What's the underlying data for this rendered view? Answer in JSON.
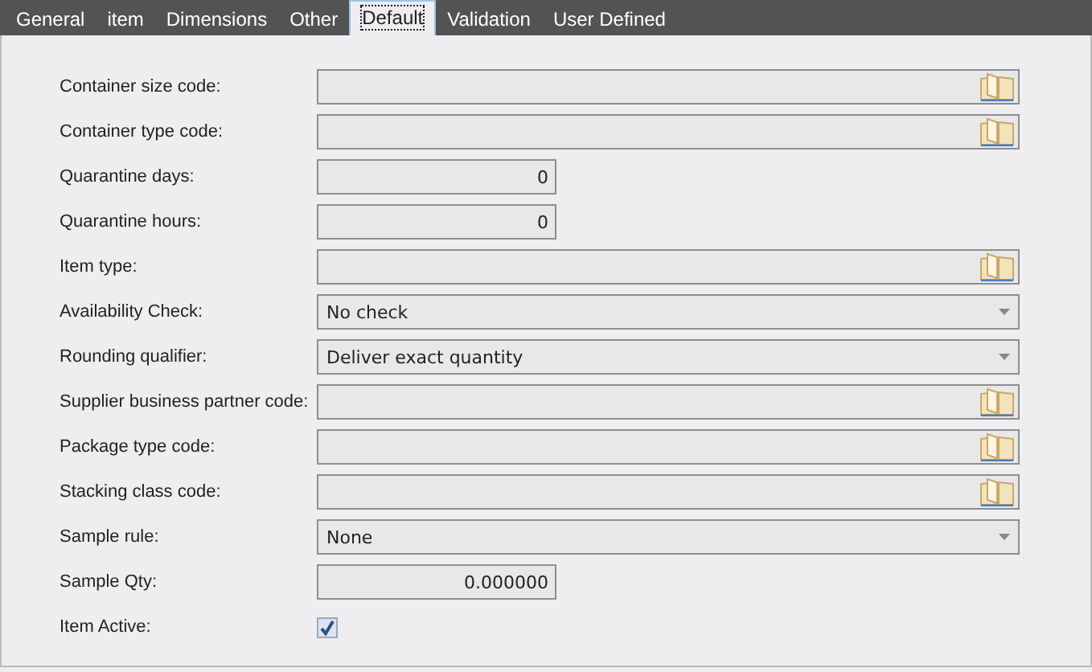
{
  "tabs": [
    {
      "label": "General",
      "selected": false
    },
    {
      "label": "item",
      "selected": false
    },
    {
      "label": "Dimensions",
      "selected": false
    },
    {
      "label": "Other",
      "selected": false
    },
    {
      "label": "Default",
      "selected": true
    },
    {
      "label": "Validation",
      "selected": false
    },
    {
      "label": "User Defined",
      "selected": false
    }
  ],
  "fields": [
    {
      "label": "Container size code:",
      "kind": "lookup"
    },
    {
      "label": "Container type code:",
      "kind": "lookup"
    },
    {
      "label": "Quarantine days:",
      "kind": "number",
      "value": "0"
    },
    {
      "label": "Quarantine hours:",
      "kind": "number",
      "value": "0"
    },
    {
      "label": "Item type:",
      "kind": "lookup"
    },
    {
      "label": "Availability Check:",
      "kind": "select",
      "value": "No check"
    },
    {
      "label": "Rounding qualifier:",
      "kind": "select",
      "value": "Deliver exact quantity"
    },
    {
      "label": "Supplier business partner code:",
      "kind": "lookup"
    },
    {
      "label": "Package type code:",
      "kind": "lookup"
    },
    {
      "label": "Stacking class code:",
      "kind": "lookup"
    },
    {
      "label": "Sample rule:",
      "kind": "select",
      "value": "None"
    },
    {
      "label": "Sample Qty:",
      "kind": "number",
      "value": "0.000000"
    },
    {
      "label": "Item Active:",
      "kind": "checkbox",
      "checked": true
    }
  ]
}
